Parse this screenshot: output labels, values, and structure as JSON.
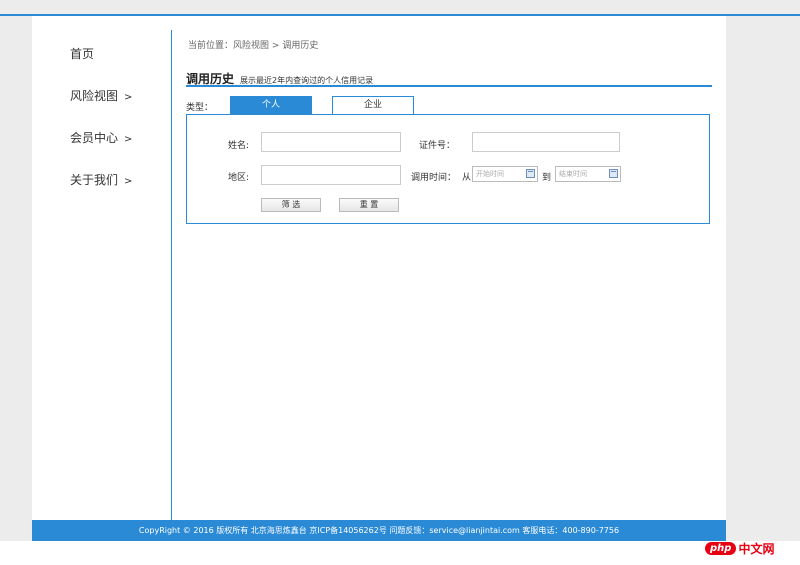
{
  "sidebar": {
    "items": [
      {
        "label": "首页",
        "arrow": ""
      },
      {
        "label": "风险视图",
        "arrow": ">"
      },
      {
        "label": "会员中心",
        "arrow": ">"
      },
      {
        "label": "关于我们",
        "arrow": ">"
      }
    ]
  },
  "breadcrumb": {
    "prefix": "当前位置：",
    "parent": "风险视图",
    "separator": ">",
    "current": "调用历史"
  },
  "page": {
    "title": "调用历史",
    "subtitle": "展示最近2年内查询过的个人信用记录"
  },
  "type_filter": {
    "label": "类型：",
    "tabs": [
      {
        "label": "个人",
        "active": true
      },
      {
        "label": "企业",
        "active": false
      }
    ]
  },
  "form": {
    "name_label": "姓名:",
    "name_value": "",
    "id_label": "证件号：",
    "id_value": "",
    "region_label": "地区:",
    "region_value": "",
    "time_label": "调用时间：",
    "from_label": "从",
    "start_placeholder": "开始时间",
    "to_label": "到",
    "end_placeholder": "结束时间",
    "filter_button": "筛 选",
    "reset_button": "重 置"
  },
  "footer": {
    "text": "CopyRight © 2016   版权所有   北京海思炼鑫台   京ICP备14056262号   问题反馈：service@lianjintai.com   客服电话：400-890-7756"
  },
  "watermark": {
    "oval_text": "php",
    "text": "中文网"
  },
  "colors": {
    "accent": "#2b8ad6",
    "background": "#ececec"
  }
}
